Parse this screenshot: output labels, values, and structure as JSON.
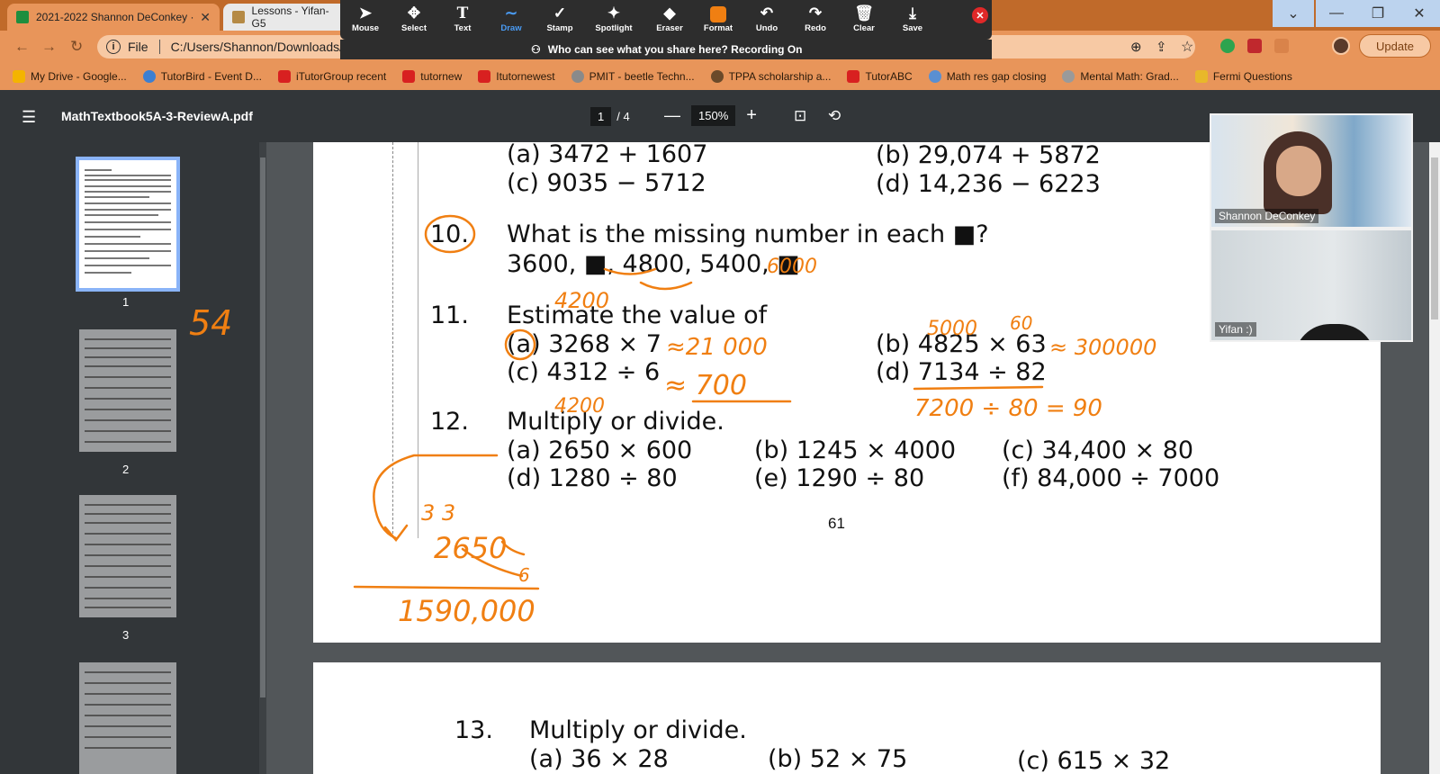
{
  "tabs": [
    {
      "label": "2021-2022 Shannon DeConkey ·",
      "icon": "sheets-icon"
    },
    {
      "label": "Lessons - Yifan-G5",
      "icon": "doc-icon"
    }
  ],
  "address": {
    "scheme": "File",
    "url": "C:/Users/Shannon/Downloads/MathTextbook5A-3-ReviewA.pdf"
  },
  "update_label": "Update",
  "bookmarks": [
    "My Drive - Google...",
    "TutorBird - Event D...",
    "iTutorGroup recent",
    "tutornew",
    "Itutornewest",
    "PMIT - beetle Techn...",
    "TPPA scholarship a...",
    "TutorABC",
    "Math res gap closing",
    "Mental Math: Grad...",
    "Fermi Questions"
  ],
  "zoom_toolbar": {
    "tools": [
      "Mouse",
      "Select",
      "Text",
      "Draw",
      "Stamp",
      "Spotlight",
      "Eraser",
      "Format",
      "Undo",
      "Redo",
      "Clear",
      "Save"
    ],
    "active_tool": "Draw",
    "notice": "Who can see what you share here? Recording On"
  },
  "pdf": {
    "filename": "MathTextbook5A-3-ReviewA.pdf",
    "current_page": "1",
    "total_pages": "/ 4",
    "zoom": "150%",
    "thumb_numbers": [
      "1",
      "2",
      "3"
    ]
  },
  "content": {
    "q9a": "(a)   3472 + 1607",
    "q9b": "(b)   29,074 + 5872",
    "q9c": "(c)   9035 − 5712",
    "q9d": "(d)   14,236 − 6223",
    "q10_num": "10.",
    "q10_text": "What is the missing number in each ■?",
    "q10_seq": "3600, ■, 4800, 5400, ■",
    "q11_num": "11.",
    "q11_text": "Estimate the value of",
    "q11a": "(a)   3268 × 7",
    "q11b": "(b)   4825 × 63",
    "q11c": "(c)   4312 ÷ 6",
    "q11d": "(d)   7134 ÷ 82",
    "q12_num": "12.",
    "q12_text": "Multiply or divide.",
    "q12a": "(a)   2650 × 600",
    "q12b": "(b)   1245 × 4000",
    "q12c": "(c)   34,400 × 80",
    "q12d": "(d)   1280 ÷ 80",
    "q12e": "(e)   1290 ÷ 80",
    "q12f": "(f)   84,000 ÷ 7000",
    "page_number": "61",
    "q13_num": "13.",
    "q13_text": "Multiply or divide.",
    "q13a": "(a)   36 × 28",
    "q13b": "(b)   52 × 75",
    "q13c": "(c)   615 × 32"
  },
  "annotations": {
    "q10_answer": "6000",
    "above_estimate": "4200",
    "q11a_answer": "≈21 000",
    "q11b_top": "5000",
    "q11b_top2": "60",
    "q11b_answer": "≈ 300000",
    "q11c_answer": "≈ 700",
    "q11c_below": "4200",
    "q11d_work": "7200 ÷ 80 = 90",
    "side_note": "54",
    "carry": "3  3",
    "work_num": "2650",
    "work_mult": "6",
    "work_result": "1590,000"
  },
  "participants": [
    "Shannon DeConkey",
    "Yifan :)"
  ],
  "colors": {
    "ink": "#f07f12",
    "tab_bar": "#c06a2a",
    "chrome": "#e8955a",
    "pdf_dark": "#323639"
  }
}
